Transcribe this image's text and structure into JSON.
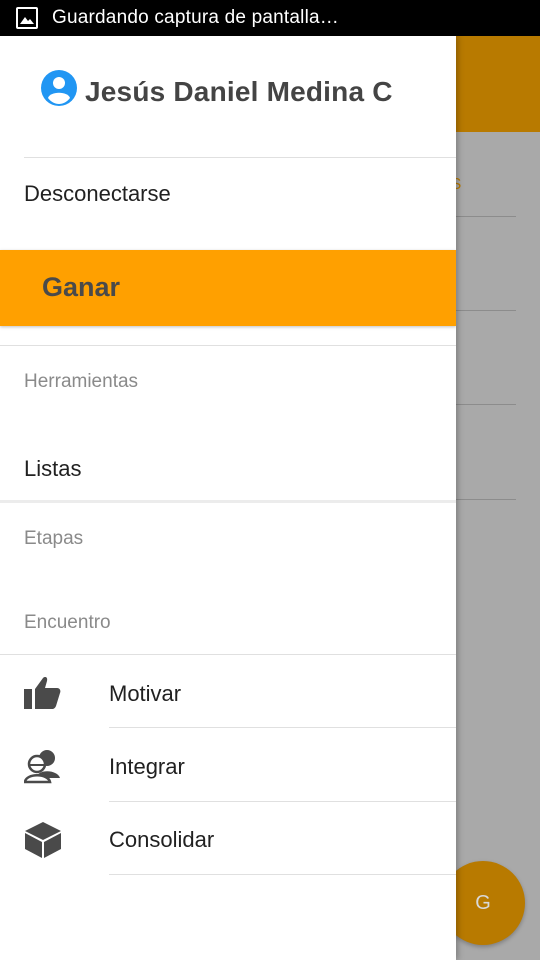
{
  "status_bar": {
    "text": "Guardando captura de pantalla…",
    "icon": "image-icon"
  },
  "background": {
    "tab_fragment": "AS",
    "fab_label": "G",
    "accent_color": "#ffa000"
  },
  "drawer": {
    "user": {
      "name": "Jesús Daniel Medina C",
      "avatar_icon": "account-circle-icon",
      "avatar_color": "#2196f3"
    },
    "logout_label": "Desconectarse",
    "highlight_item": {
      "label": "Ganar",
      "color": "#ffa000"
    },
    "sections": {
      "tools": "Herramientas",
      "stages": "Etapas",
      "meeting": "Encuentro"
    },
    "lists_label": "Listas",
    "actions": [
      {
        "label": "Motivar",
        "icon": "thumbs-up-icon"
      },
      {
        "label": "Integrar",
        "icon": "people-icon"
      },
      {
        "label": "Consolidar",
        "icon": "cube-icon"
      }
    ]
  }
}
